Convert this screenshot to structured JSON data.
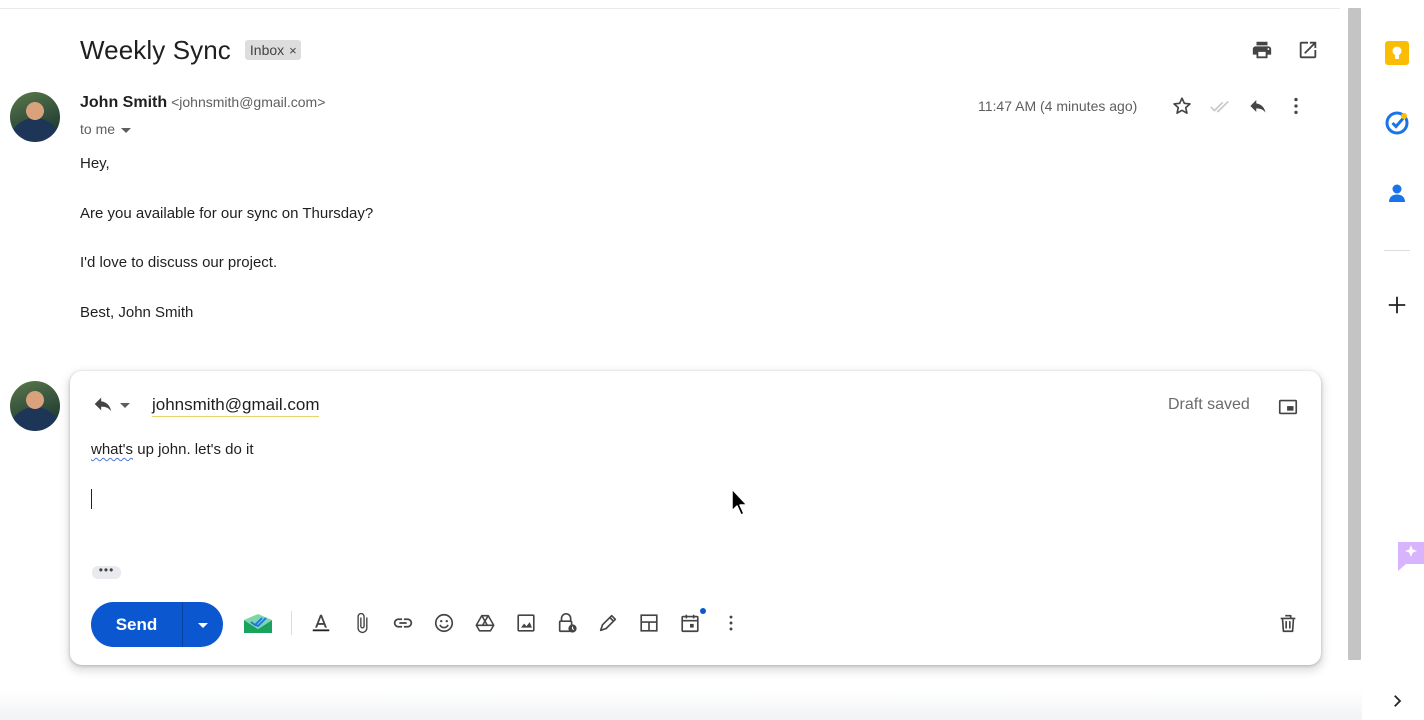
{
  "email": {
    "subject": "Weekly Sync",
    "label": "Inbox",
    "label_close": "×",
    "sender_name": "John Smith",
    "sender_email": "<johnsmith@gmail.com>",
    "to_text": "to me",
    "timestamp": "11:47 AM (4 minutes ago)",
    "body": [
      "Hey,",
      "Are you available for our sync on Thursday?",
      "I'd love to discuss our project.",
      "Best, John Smith"
    ]
  },
  "compose": {
    "recipient": "johnsmith@gmail.com",
    "status": "Draft saved",
    "text_word": "what's",
    "text_rest": " up john. let's do it",
    "more_dots": "•••",
    "send_label": "Send"
  },
  "colors": {
    "send_blue": "#0b57d0",
    "keep_yellow": "#fbbc04",
    "tasks_blue": "#1a73e8"
  },
  "icons": {
    "top": [
      "print-icon",
      "open-in-new-window-icon"
    ],
    "message": [
      "star-icon",
      "read-receipt-icon",
      "reply-icon",
      "more-vert-icon"
    ],
    "toolbar": [
      "mailtrack-icon",
      "text-format-icon",
      "attach-icon",
      "link-icon",
      "emoji-icon",
      "drive-icon",
      "photo-icon",
      "confidential-lock-icon",
      "signature-pen-icon",
      "layout-template-icon",
      "schedule-calendar-icon",
      "more-options-icon"
    ],
    "side": [
      "keep-icon",
      "tasks-icon",
      "contacts-icon",
      "add-icon",
      "gemini-icon",
      "expand-chevron-icon"
    ]
  }
}
